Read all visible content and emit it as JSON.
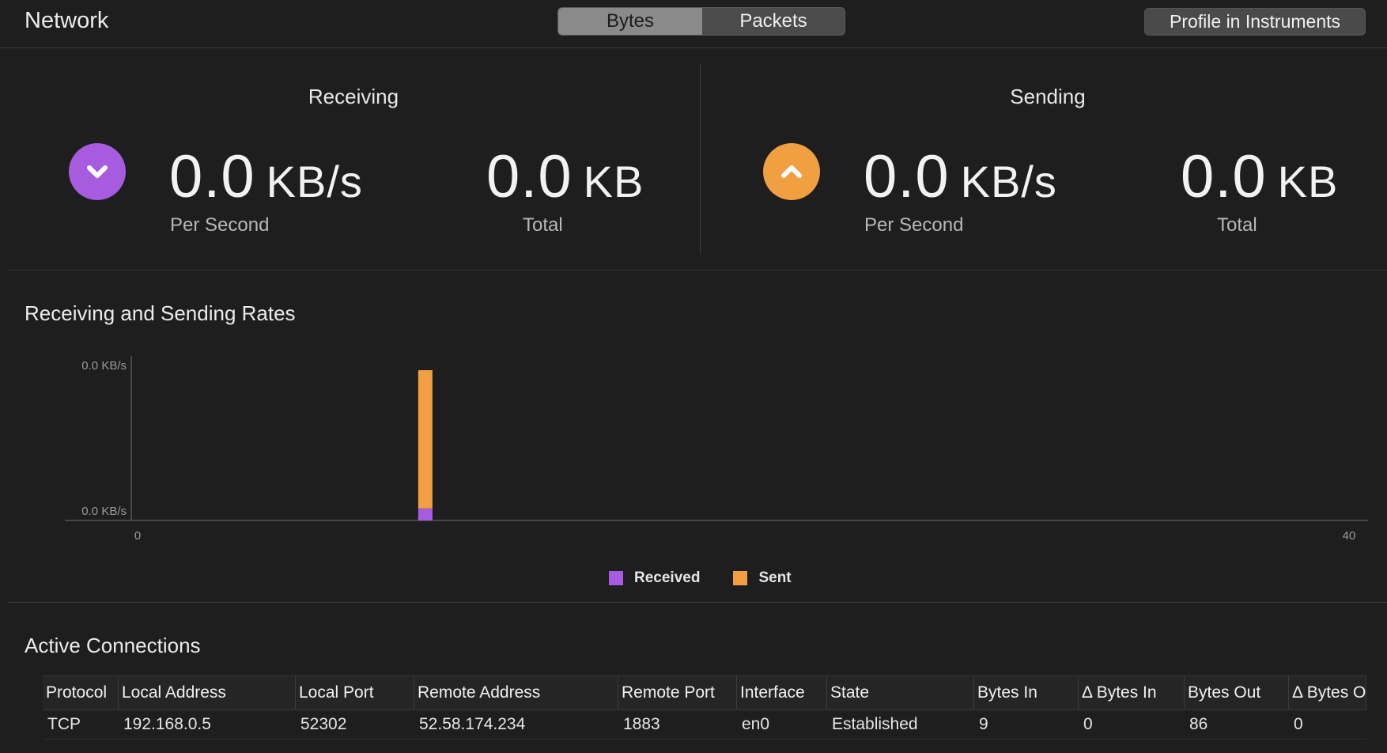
{
  "window": {
    "title": "Network"
  },
  "mode_toggle": {
    "options": [
      "Bytes",
      "Packets"
    ],
    "selected": "Bytes"
  },
  "toolbar": {
    "profile_label": "Profile in Instruments"
  },
  "receiving": {
    "title": "Receiving",
    "icon": "chevron-down-circle",
    "color": "#a75ce0",
    "rate_value": "0.0",
    "rate_unit": "KB/s",
    "rate_label": "Per Second",
    "total_value": "0.0",
    "total_unit": "KB",
    "total_label": "Total"
  },
  "sending": {
    "title": "Sending",
    "icon": "chevron-up-circle",
    "color": "#f0a040",
    "rate_value": "0.0",
    "rate_unit": "KB/s",
    "rate_label": "Per Second",
    "total_value": "0.0",
    "total_unit": "KB",
    "total_label": "Total"
  },
  "chart_section": {
    "title": "Receiving and Sending Rates"
  },
  "chart_data": {
    "type": "bar",
    "stacked": true,
    "x_ticks": [
      "0",
      "40"
    ],
    "y_ticks": [
      "0.0 KB/s",
      "0.0 KB/s"
    ],
    "xlim": [
      0,
      40
    ],
    "ylim": [
      0,
      1
    ],
    "x": [
      9.5
    ],
    "series": [
      {
        "name": "Received",
        "color": "#a75ce0",
        "values": [
          0.08
        ]
      },
      {
        "name": "Sent",
        "color": "#f0a040",
        "values": [
          0.92
        ]
      }
    ],
    "legend": "bottom-center"
  },
  "connections": {
    "title": "Active Connections",
    "columns": [
      "Protocol",
      "Local Address",
      "Local Port",
      "Remote Address",
      "Remote Port",
      "Interface",
      "State",
      "Bytes In",
      "Δ Bytes In",
      "Bytes Out",
      "Δ Bytes O"
    ],
    "rows": [
      [
        "TCP",
        "192.168.0.5",
        "52302",
        "52.58.174.234",
        "1883",
        "en0",
        "Established",
        "9",
        "0",
        "86",
        "0"
      ]
    ]
  }
}
